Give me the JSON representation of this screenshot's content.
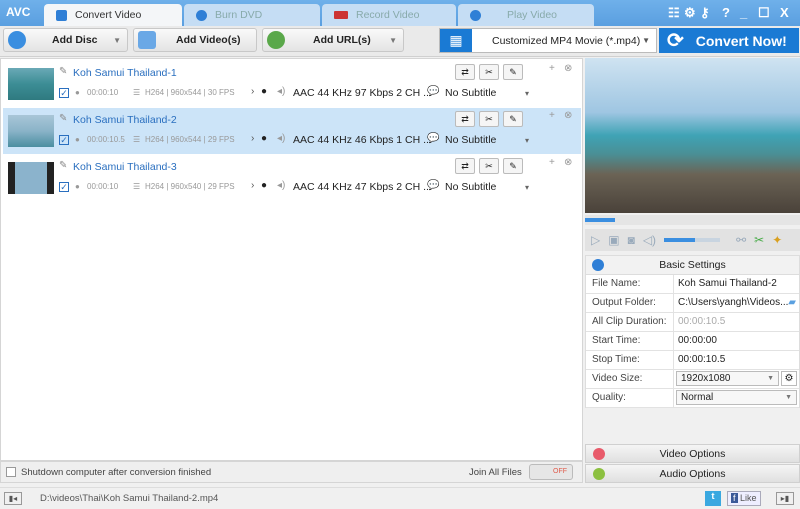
{
  "app": {
    "logo": "AVC"
  },
  "tabs": [
    {
      "label": "Convert Video",
      "active": true
    },
    {
      "label": "Burn DVD"
    },
    {
      "label": "Record Video"
    },
    {
      "label": "Play Video"
    }
  ],
  "window_controls": {
    "help": "?",
    "minimize": "_",
    "maximize": "☐",
    "close": "X"
  },
  "toolbar": {
    "add_disc": "Add Disc",
    "add_videos": "Add Video(s)",
    "add_url": "Add URL(s)",
    "profile": "Customized MP4 Movie (*.mp4)",
    "convert": "Convert Now!"
  },
  "files": [
    {
      "name": "Koh Samui Thailand-1",
      "duration": "00:00:10",
      "video": "H264 | 960x544 | 30 FPS",
      "audio": "AAC 44 KHz 97 Kbps 2 CH ...",
      "subtitle": "No Subtitle",
      "selected": false
    },
    {
      "name": "Koh Samui Thailand-2",
      "duration": "00:00:10.5",
      "video": "H264 | 960x544 | 29 FPS",
      "audio": "AAC 44 KHz 46 Kbps 1 CH ...",
      "subtitle": "No Subtitle",
      "selected": true
    },
    {
      "name": "Koh Samui Thailand-3",
      "duration": "00:00:10",
      "video": "H264 | 960x540 | 29 FPS",
      "audio": "AAC 44 KHz 47 Kbps 2 CH ...",
      "subtitle": "No Subtitle",
      "selected": false
    }
  ],
  "bottom": {
    "shutdown": "Shutdown computer after conversion finished",
    "join": "Join All Files",
    "toggle": "OFF"
  },
  "player": {
    "seek_progress": 0.14,
    "volume": 0.55
  },
  "basic_settings": {
    "title": "Basic Settings",
    "rows": [
      {
        "label": "File Name:",
        "value": "Koh Samui Thailand-2"
      },
      {
        "label": "Output Folder:",
        "value": "C:\\Users\\yangh\\Videos..."
      },
      {
        "label": "All Clip Duration:",
        "value": "00:00:10.5"
      },
      {
        "label": "Start Time:",
        "value": "00:00:00"
      },
      {
        "label": "Stop Time:",
        "value": "00:00:10.5"
      },
      {
        "label": "Video Size:",
        "value": "1920x1080"
      },
      {
        "label": "Quality:",
        "value": "Normal"
      }
    ]
  },
  "options": {
    "video": "Video Options",
    "audio": "Audio Options"
  },
  "status": {
    "path": "D:\\videos\\Thai\\Koh Samui Thailand-2.mp4",
    "like": "Like"
  }
}
